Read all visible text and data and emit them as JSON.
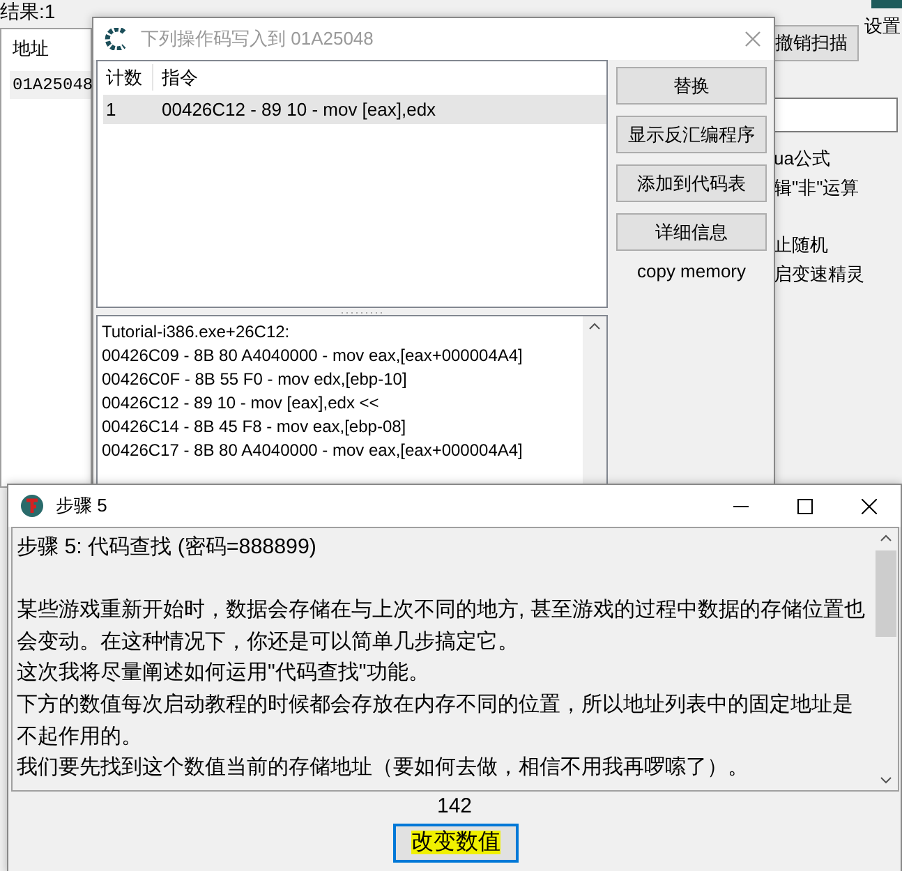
{
  "main": {
    "results_label": "结果:1",
    "address_header": "地址",
    "addresses": [
      "01A25048"
    ],
    "undo_scan_button": "撤销扫描",
    "settings_label": "设置",
    "options": [
      "ua公式",
      "辑\"非\"运算",
      "止随机",
      "启变速精灵"
    ]
  },
  "opcode_dialog": {
    "title": "下列操作码写入到 01A25048",
    "columns": [
      "计数",
      "指令"
    ],
    "rows": [
      {
        "count": "1",
        "instruction": "00426C12 - 89 10  - mov [eax],edx",
        "selected": true
      }
    ],
    "buttons": [
      "替换",
      "显示反汇编程序",
      "添加到代码表",
      "详细信息"
    ],
    "copy_memory_label": "copy memory",
    "disassembly": [
      "Tutorial-i386.exe+26C12:",
      "00426C09 - 8B 80 A4040000  - mov eax,[eax+000004A4]",
      "00426C0F - 8B 55 F0  - mov edx,[ebp-10]",
      "00426C12 - 89 10  - mov [eax],edx <<",
      "00426C14 - 8B 45 F8  - mov eax,[ebp-08]",
      "00426C17 - 8B 80 A4040000  - mov eax,[eax+000004A4]"
    ]
  },
  "step_window": {
    "title": "步骤 5",
    "heading": "步骤 5: 代码查找 (密码=888899)",
    "paragraphs": [
      "某些游戏重新开始时，数据会存储在与上次不同的地方, 甚至游戏的过程中数据的存储位置也会变动。在这种情况下，你还是可以简单几步搞定它。",
      "这次我将尽量阐述如何运用\"代码查找\"功能。",
      "下方的数值每次启动教程的时候都会存放在内存不同的位置，所以地址列表中的固定地址是不起作用的。",
      "我们要先找到这个数值当前的存储地址（要如何去做，相信不用我再啰嗦了）。"
    ],
    "value": "142",
    "change_button": "改变数值"
  }
}
